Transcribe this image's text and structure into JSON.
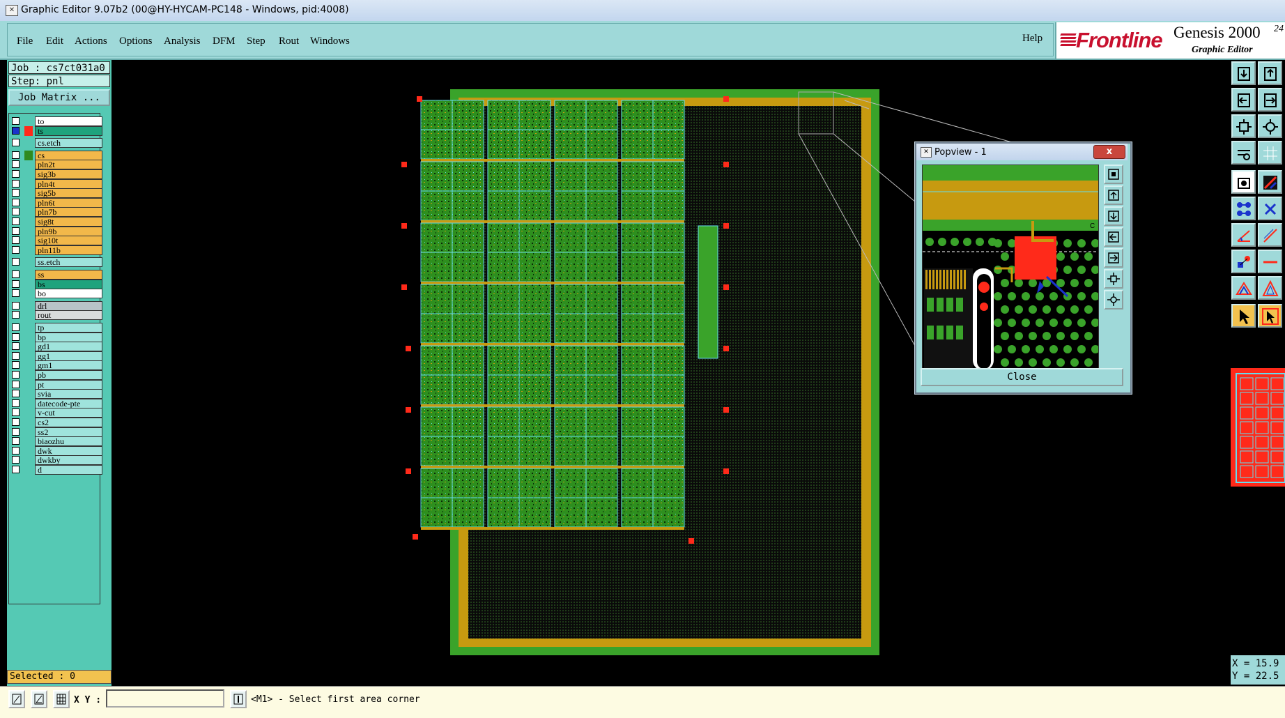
{
  "window": {
    "title": "Graphic Editor 9.07b2 (00@HY-HYCAM-PC148 - Windows, pid:4008)"
  },
  "menu": {
    "items": [
      "File",
      "Edit",
      "Actions",
      "Options",
      "Analysis",
      "DFM",
      "Step",
      "Rout",
      "Windows"
    ],
    "help": "Help"
  },
  "logo": {
    "brand": "Frontline",
    "product": "Genesis 2000",
    "subtitle": "Graphic Editor",
    "version_fragment": "24"
  },
  "job": {
    "job_line": "Job : cs7ct031a0",
    "step_line": "Step: pnl",
    "matrix_button": "Job Matrix ..."
  },
  "layers": [
    {
      "name": "to",
      "bg": "#ffffff",
      "dot": "",
      "checked": false
    },
    {
      "name": "ts",
      "bg": "#1fa37d",
      "dot": "#ff2a1a",
      "checked": true
    },
    {
      "name": "cs.etch",
      "bg": "#9fe3dc",
      "dot": "",
      "checked": false
    },
    {
      "name": "cs",
      "bg": "#f2b84a",
      "dot": "#2f8a20",
      "checked": false
    },
    {
      "name": "pln2t",
      "bg": "#f2b84a",
      "dot": "",
      "checked": false
    },
    {
      "name": "sig3b",
      "bg": "#f2b84a",
      "dot": "",
      "checked": false
    },
    {
      "name": "pln4t",
      "bg": "#f2b84a",
      "dot": "",
      "checked": false
    },
    {
      "name": "sig5b",
      "bg": "#f2b84a",
      "dot": "",
      "checked": false
    },
    {
      "name": "pln6t",
      "bg": "#f2b84a",
      "dot": "",
      "checked": false
    },
    {
      "name": "pln7b",
      "bg": "#f2b84a",
      "dot": "",
      "checked": false
    },
    {
      "name": "sig8t",
      "bg": "#f2b84a",
      "dot": "",
      "checked": false
    },
    {
      "name": "pln9b",
      "bg": "#f2b84a",
      "dot": "",
      "checked": false
    },
    {
      "name": "sig10t",
      "bg": "#f2b84a",
      "dot": "",
      "checked": false
    },
    {
      "name": "pln11b",
      "bg": "#f2b84a",
      "dot": "",
      "checked": false
    },
    {
      "name": "ss.etch",
      "bg": "#9fe3dc",
      "dot": "",
      "checked": false
    },
    {
      "name": "ss",
      "bg": "#f2b84a",
      "dot": "",
      "checked": false
    },
    {
      "name": "bs",
      "bg": "#1fa37d",
      "dot": "",
      "checked": false
    },
    {
      "name": "bo",
      "bg": "#ffffff",
      "dot": "",
      "checked": false
    },
    {
      "name": "drl",
      "bg": "#b8c4c8",
      "dot": "",
      "checked": false
    },
    {
      "name": "rout",
      "bg": "#d8dcdc",
      "dot": "",
      "checked": false
    },
    {
      "name": "tp",
      "bg": "#9fe3dc",
      "dot": "",
      "checked": false
    },
    {
      "name": "bp",
      "bg": "#9fe3dc",
      "dot": "",
      "checked": false
    },
    {
      "name": "gd1",
      "bg": "#9fe3dc",
      "dot": "",
      "checked": false
    },
    {
      "name": "gg1",
      "bg": "#9fe3dc",
      "dot": "",
      "checked": false
    },
    {
      "name": "gm1",
      "bg": "#9fe3dc",
      "dot": "",
      "checked": false
    },
    {
      "name": "pb",
      "bg": "#9fe3dc",
      "dot": "",
      "checked": false
    },
    {
      "name": "pt",
      "bg": "#9fe3dc",
      "dot": "",
      "checked": false
    },
    {
      "name": "svia",
      "bg": "#9fe3dc",
      "dot": "",
      "checked": false
    },
    {
      "name": "datecode-pte",
      "bg": "#9fe3dc",
      "dot": "",
      "checked": false
    },
    {
      "name": "v-cut",
      "bg": "#9fe3dc",
      "dot": "",
      "checked": false
    },
    {
      "name": "cs2",
      "bg": "#9fe3dc",
      "dot": "",
      "checked": false
    },
    {
      "name": "ss2",
      "bg": "#9fe3dc",
      "dot": "",
      "checked": false
    },
    {
      "name": "biaozhu",
      "bg": "#9fe3dc",
      "dot": "",
      "checked": false
    },
    {
      "name": "dwk",
      "bg": "#9fe3dc",
      "dot": "",
      "checked": false
    },
    {
      "name": "dwkby",
      "bg": "#9fe3dc",
      "dot": "",
      "checked": false
    },
    {
      "name": "d",
      "bg": "#9fe3dc",
      "dot": "",
      "checked": false
    }
  ],
  "status": {
    "selected": "Selected : 0",
    "xy_label": "X Y :",
    "xy_value": "",
    "message": "<M1> - Select first area corner"
  },
  "coords": {
    "x": "X = 15.9",
    "y": "Y = 22.5"
  },
  "popview": {
    "title": "Popview - 1",
    "close_x": "x",
    "close_button": "Close",
    "corner_label": "C"
  },
  "colors": {
    "panel_teal": "#55c9b4",
    "menu_teal": "#9fd9d9",
    "board_green": "#3aa32a",
    "copper": "#c79a10",
    "pad_red": "#ff2a1a",
    "selected_yellow": "#f2c24f"
  }
}
